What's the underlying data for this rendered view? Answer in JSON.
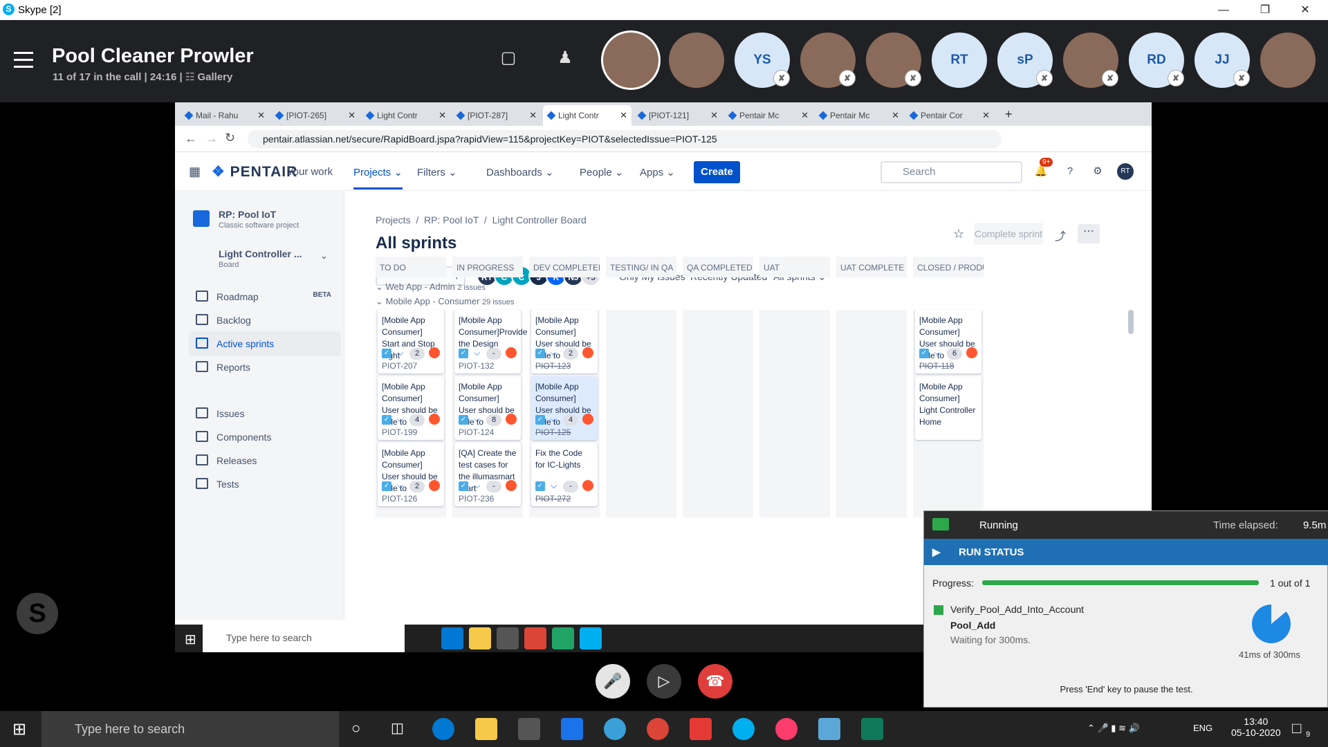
{
  "skype": {
    "window_title": "Skype [2]",
    "logo": "S"
  },
  "call": {
    "title": "Pool Cleaner Prowler",
    "subtitle": "11 of 17 in the call | 24:16 |",
    "view": "Gallery"
  },
  "participants": [
    {
      "label": "",
      "type": "photo",
      "selected": true
    },
    {
      "label": "",
      "type": "photo"
    },
    {
      "label": "YS",
      "type": "initials",
      "muted": true
    },
    {
      "label": "",
      "type": "photo",
      "muted": true
    },
    {
      "label": "",
      "type": "photo",
      "muted": true
    },
    {
      "label": "RT",
      "type": "initials"
    },
    {
      "label": "sP",
      "type": "initials",
      "muted": true
    },
    {
      "label": "",
      "type": "photo",
      "muted": true
    },
    {
      "label": "RD",
      "type": "initials",
      "muted": true
    },
    {
      "label": "JJ",
      "type": "initials",
      "muted": true
    },
    {
      "label": "",
      "type": "photo"
    }
  ],
  "browser": {
    "tabs": [
      "Mail - Rahu",
      "[PIOT-265]",
      "Light Contr",
      "[PIOT-287]",
      "Light Contr",
      "[PIOT-121]",
      "Pentair Mc",
      "Pentair Mc",
      "Pentair Cor"
    ],
    "active_tab": 4,
    "url": "pentair.atlassian.net/secure/RapidBoard.jspa?rapidView=115&projectKey=PIOT&selectedIssue=PIOT-125"
  },
  "jira": {
    "logo": "PENTAIR",
    "nav": [
      "Your work",
      "Projects",
      "Filters",
      "Dashboards",
      "People",
      "Apps"
    ],
    "create": "Create",
    "search_placeholder": "Search",
    "notif_badge": "9+",
    "user": "RT"
  },
  "sidebar": {
    "project_name": "RP: Pool IoT",
    "project_type": "Classic software project",
    "board_name": "Light Controller ...",
    "board_label": "Board",
    "items": [
      {
        "label": "Roadmap",
        "badge": "BETA"
      },
      {
        "label": "Backlog"
      },
      {
        "label": "Active sprints",
        "active": true
      },
      {
        "label": "Reports"
      },
      {
        "label": "Issues"
      },
      {
        "label": "Components"
      },
      {
        "label": "Releases"
      },
      {
        "label": "Tests"
      }
    ]
  },
  "board": {
    "breadcrumb": [
      "Projects",
      "RP: Pool IoT",
      "Light Controller Board"
    ],
    "title": "All sprints",
    "complete_sprint": "Complete sprint",
    "filters": [
      "Only My Issues",
      "Recently Updated",
      "All sprints"
    ],
    "avatars": [
      "RT",
      "C",
      "C",
      "J",
      "K",
      "NJ",
      "+5"
    ],
    "columns": [
      "TO DO",
      "IN PROGRESS",
      "DEV COMPLETED",
      "TESTING/ IN QA",
      "QA COMPLETED",
      "UAT",
      "UAT COMPLETE",
      "CLOSED / PRODU..."
    ],
    "swimlanes": [
      {
        "name": "Web App - Admin",
        "count": "2 issues"
      },
      {
        "name": "Mobile App - Consumer",
        "count": "29 issues"
      }
    ],
    "cards": [
      {
        "col": 0,
        "row": 0,
        "text": "[Mobile App Consumer] Start and Stop Light",
        "pts": "2",
        "key": "PIOT-207"
      },
      {
        "col": 1,
        "row": 0,
        "text": "[Mobile App Consumer]Provide the Design",
        "pts": "-",
        "key": "PIOT-132"
      },
      {
        "col": 2,
        "row": 0,
        "text": "[Mobile App Consumer] User should be able to",
        "pts": "2",
        "key": "PIOT-123",
        "done": true
      },
      {
        "col": 7,
        "row": 0,
        "text": "[Mobile App Consumer] User should be able to",
        "pts": "6",
        "key": "PIOT-118",
        "done": true
      },
      {
        "col": 0,
        "row": 1,
        "text": "[Mobile App Consumer] User should be able to",
        "pts": "4",
        "key": "PIOT-199"
      },
      {
        "col": 1,
        "row": 1,
        "text": "[Mobile App Consumer] User should be able to",
        "pts": "8",
        "key": "PIOT-124"
      },
      {
        "col": 2,
        "row": 1,
        "text": "[Mobile App Consumer] User should be able to",
        "pts": "4",
        "key": "PIOT-125",
        "done": true,
        "selected": true
      },
      {
        "col": 7,
        "row": 1,
        "text": "[Mobile App Consumer] Light Controller Home",
        "pts": "",
        "key": ""
      },
      {
        "col": 0,
        "row": 2,
        "text": "[Mobile App Consumer] User should be able to",
        "pts": "2",
        "key": "PIOT-126"
      },
      {
        "col": 1,
        "row": 2,
        "text": "[QA] Create the test cases for the illumasmart Start",
        "pts": "-",
        "key": "PIOT-236"
      },
      {
        "col": 2,
        "row": 2,
        "text": "Fix the Code for IC-Lights",
        "pts": "-",
        "key": "PIOT-272",
        "done": true
      }
    ]
  },
  "inner_taskbar": {
    "search_placeholder": "Type here to search"
  },
  "run_panel": {
    "status": "Running",
    "elapsed_label": "Time elapsed:",
    "elapsed": "9.5m",
    "header": "RUN STATUS",
    "progress_label": "Progress:",
    "progress_text": "1 out of 1",
    "progress_fraction": 1.0,
    "test_name": "Verify_Pool_Add_Into_Account",
    "step": "Pool_Add",
    "wait": "Waiting for 300ms.",
    "timer": "41ms of 300ms",
    "hint": "Press 'End' key to pause the test."
  },
  "taskbar": {
    "search_placeholder": "Type here to search",
    "lang": "ENG",
    "time": "13:40",
    "date": "05-10-2020",
    "notif_count": "9"
  }
}
